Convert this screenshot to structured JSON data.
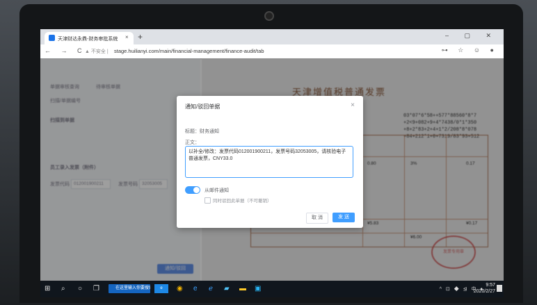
{
  "browser": {
    "tab_title": "天津财达永鼎-财务审批系统",
    "tab_close": "×",
    "new_tab": "+",
    "window_controls": "– ▢ ✕",
    "nav_buttons": "← → C",
    "security_label": "▲ 不安全 |",
    "url": "stage.huilianyi.com/main/financial-management/finance-audit/tab",
    "address_icons": "⊶ ☆ ☺ ●"
  },
  "left_panel": {
    "tab_1": "单据审核查询",
    "tab_2": "待审核单据",
    "search_label": "扫描/单据编号",
    "scan_title": "扫描到单据",
    "section_title": "员工录入发票（附件）",
    "invoice_code_label": "发票代码",
    "invoice_code_value": "012001900211",
    "invoice_no_label": "发票号码",
    "invoice_no_value": "32053005",
    "notify_button": "通知/驳回"
  },
  "invoice": {
    "title": "天津增值税普通发票",
    "code_block": "03*07*6*58++577*88560*8*7\n+2<9+082+9+4*7438/0*1*350\n+8+2*83+2+4+1*2/208*8*078\n+84+212*1+0+7319/83*93+512",
    "seal_text": "发票专用章",
    "cell_1": "0.80",
    "cell_2": "3%",
    "cell_3": "0.17",
    "cell_4": "¥5.83",
    "cell_5": "¥6.00",
    "cell_6": "¥0.17"
  },
  "dialog": {
    "title": "通知/驳回单据",
    "close": "×",
    "title_field": "标题：财务通知",
    "body_label": "正文：",
    "body_text": "以补全/修改：发票代码012001900211，发票号码32053005，请核验电子普通发票，CNY33.0",
    "toggle_label": "从邮件通知",
    "checkbox_label": "同时驳回此单据（不可撤销）",
    "cancel_label": "取 消",
    "send_label": "发 送"
  },
  "taskbar": {
    "start_icon": "⊞",
    "search_icon": "⌕",
    "cortana_icon": "○",
    "taskview_icon": "❐",
    "search_text": "在这里输入你要搜索的内容",
    "app_label": "e",
    "tray": "^ ⊡ ◆ ⊴ 中 ♦",
    "time": "9:57",
    "date": "2020/2/27"
  },
  "colors": {
    "primary": "#409eff",
    "invoice_red": "#c44444",
    "taskbar_bg": "#10161d"
  }
}
